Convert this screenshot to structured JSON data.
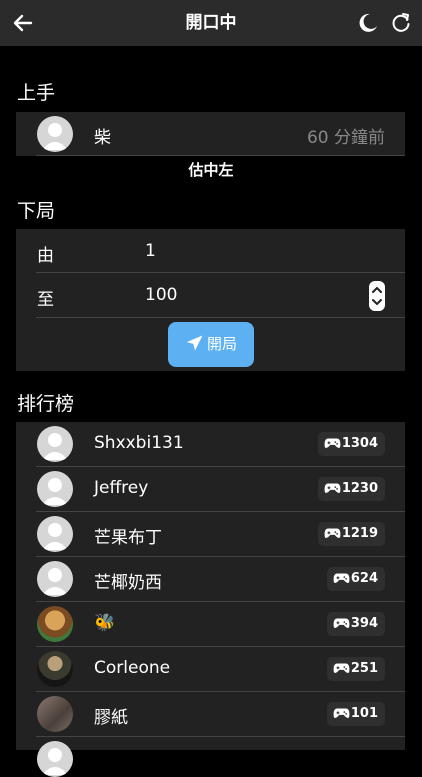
{
  "header": {
    "title": "開口中"
  },
  "sections": {
    "prev_hand": "上手",
    "next_round": "下局",
    "leaderboard": "排行榜"
  },
  "prev_hand": {
    "name": "柴",
    "time": "60 分鐘前",
    "result": "估中左"
  },
  "range": {
    "from_label": "由",
    "from_value": "1",
    "to_label": "至",
    "to_value": "100",
    "start_label": "開局"
  },
  "leaderboard": [
    {
      "name": "Shxxbi131",
      "score": "1304"
    },
    {
      "name": "Jeffrey",
      "score": "1230"
    },
    {
      "name": "芒果布丁",
      "score": "1219"
    },
    {
      "name": "芒椰奶西",
      "score": "624"
    },
    {
      "name": "🐝",
      "score": "394"
    },
    {
      "name": "Corleone",
      "score": "251"
    },
    {
      "name": "膠紙",
      "score": "101"
    }
  ],
  "colors": {
    "accent": "#5db0f2",
    "card": "#222222",
    "header": "#2b2b2b"
  }
}
